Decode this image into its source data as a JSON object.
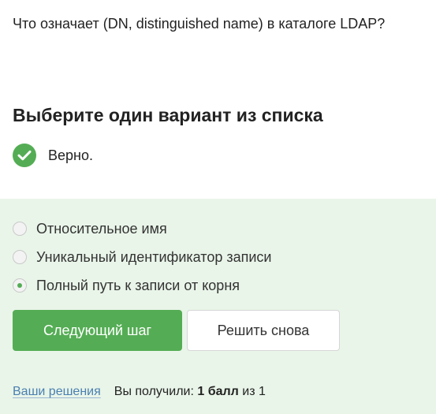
{
  "question": {
    "text": "Что означает (DN, distinguished name) в каталоге LDAP?"
  },
  "instruction": "Выберите один вариант из списка",
  "result": {
    "icon": "check-icon",
    "text": "Верно.",
    "color": "#54ad54"
  },
  "options": [
    {
      "label": "Относительное имя",
      "selected": false
    },
    {
      "label": "Уникальный идентификатор записи",
      "selected": false
    },
    {
      "label": "Полный путь к записи от корня",
      "selected": true
    }
  ],
  "buttons": {
    "next": "Следующий шаг",
    "retry": "Решить снова"
  },
  "footer": {
    "solutions_link": "Ваши решения",
    "score_prefix": "Вы получили:",
    "score_value": "1 балл",
    "score_suffix": "из 1"
  },
  "colors": {
    "accent": "#54ad54",
    "feedback_background": "#e9f5e9",
    "link": "#4a7fb0"
  }
}
